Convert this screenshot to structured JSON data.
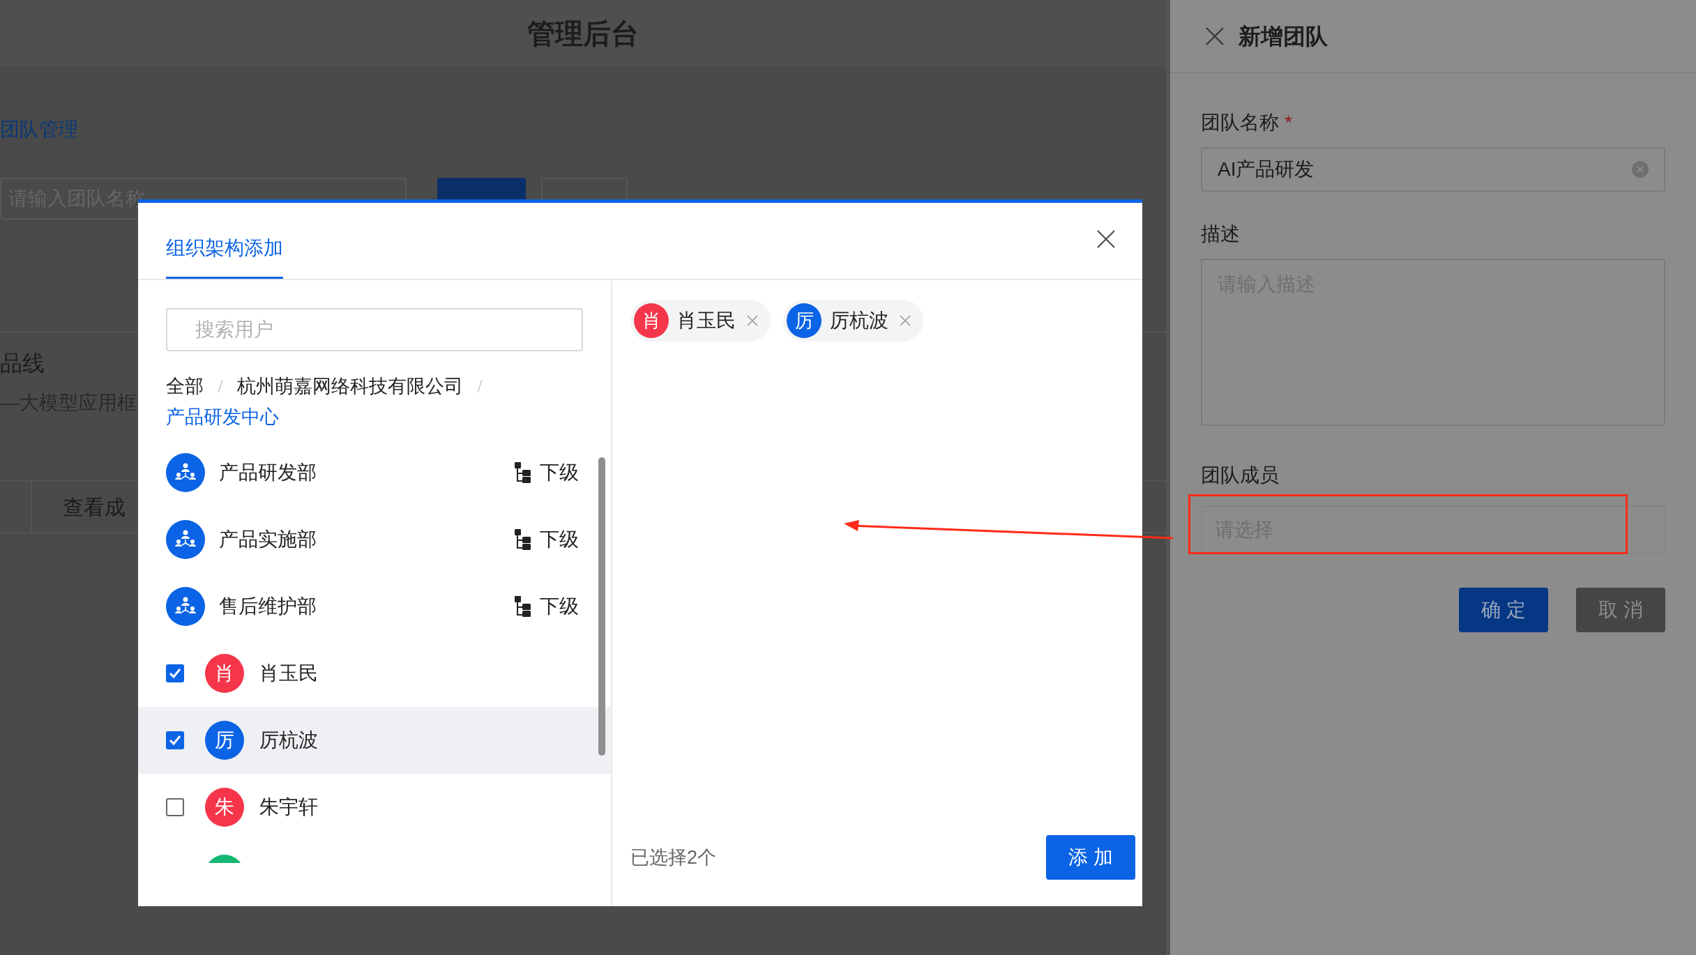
{
  "page": {
    "title": "管理后台",
    "section_link": "团队管理",
    "search": {
      "placeholder": "请输入团队名称"
    },
    "product_line": "品线",
    "product_desc": "—大模型应用框",
    "row_action": "查看成"
  },
  "modal": {
    "tabs": [
      {
        "label": "组织架构添加",
        "selected": true
      }
    ],
    "search": {
      "placeholder": "搜索用户"
    },
    "breadcrumb": [
      {
        "label": "全部",
        "current": false
      },
      {
        "label": "杭州萌嘉网络科技有限公司",
        "current": false
      },
      {
        "label": "产品研发中心",
        "current": true
      }
    ],
    "items": [
      {
        "kind": "department",
        "name": "产品研发部",
        "action": "下级",
        "selected": false
      },
      {
        "kind": "department",
        "name": "产品实施部",
        "action": "下级",
        "selected": false
      },
      {
        "kind": "department",
        "name": "售后维护部",
        "action": "下级",
        "selected": false
      },
      {
        "kind": "user",
        "name": "肖玉民",
        "avatar": "肖",
        "color": "#f5364a",
        "checked": true,
        "selected": false
      },
      {
        "kind": "user",
        "name": "厉杭波",
        "avatar": "厉",
        "color": "#0b63e5",
        "checked": true,
        "selected": true
      },
      {
        "kind": "user",
        "name": "朱宇轩",
        "avatar": "朱",
        "color": "#f5364a",
        "checked": false,
        "selected": false
      },
      {
        "kind": "user",
        "color": "#15b872",
        "selected": false
      }
    ],
    "chips": [
      {
        "avatar": "肖",
        "name": "肖玉民",
        "color": "#f5364a"
      },
      {
        "avatar": "厉",
        "name": "厉杭波",
        "color": "#0b63e5"
      }
    ],
    "selected_count": "已选择2个",
    "add_button": "添 加"
  },
  "drawer": {
    "title": "新增团队",
    "name_field": {
      "label": "团队名称",
      "required_mark": "*",
      "value": "AI产品研发"
    },
    "desc_field": {
      "label": "描述",
      "placeholder": "请输入描述"
    },
    "members_field": {
      "label": "团队成员",
      "placeholder": "请选择",
      "highlighted": true
    },
    "buttons": [
      {
        "kind": "primary",
        "label": "确 定"
      },
      {
        "kind": "default",
        "label": "取 消"
      }
    ]
  }
}
